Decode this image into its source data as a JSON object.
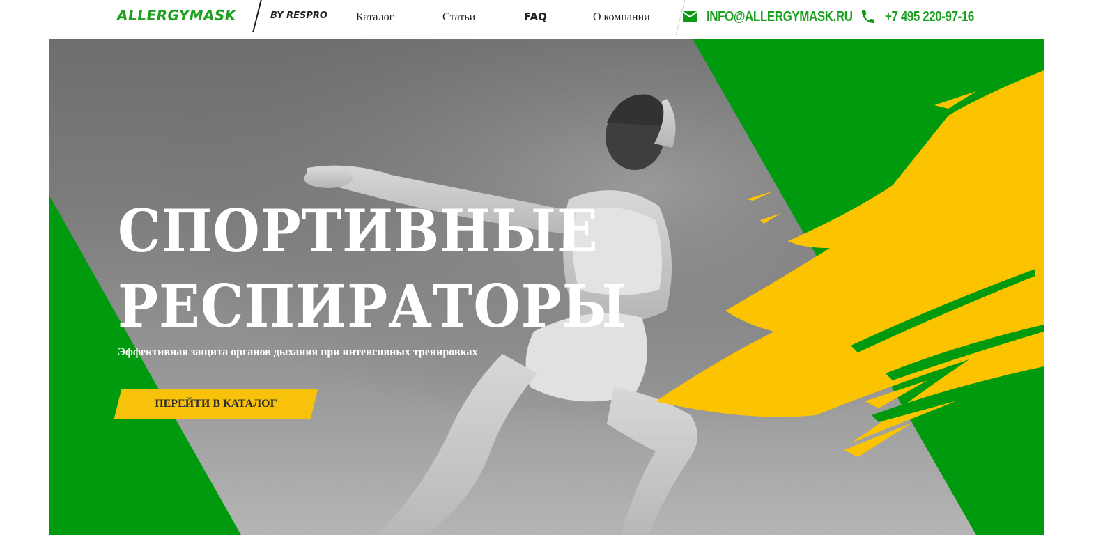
{
  "header": {
    "logo": "ALLERGYMASK",
    "logo_by": "BY RESPRO",
    "nav": [
      {
        "label": "Каталог"
      },
      {
        "label": "Статьи"
      },
      {
        "label": "FAQ"
      },
      {
        "label": "О компании"
      }
    ],
    "email": "INFO@ALLERGYMASK.RU",
    "phone": "+7 495 220-97-16",
    "icons": {
      "email": "envelope-icon",
      "phone": "phone-icon"
    }
  },
  "hero": {
    "title_line1": "СПОРТИВНЫЕ",
    "title_line2": "РЕСПИРАТОРЫ",
    "subtitle": "Эффективная защита органов дыхания при интенсивных тренировках",
    "cta_label": "ПЕРЕЙТИ В КАТАЛОГ"
  },
  "colors": {
    "brand_green": "#009a0e",
    "accent_yellow": "#fbc300",
    "text_dark": "#222222"
  }
}
